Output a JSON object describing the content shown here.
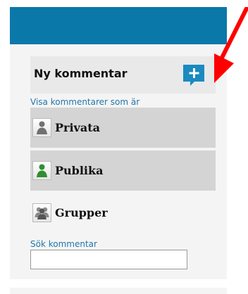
{
  "new_comment": {
    "label": "Ny kommentar",
    "add_icon": "plus-icon"
  },
  "filter": {
    "label": "Visa kommentarer som är",
    "options": [
      {
        "label": "Privata",
        "icon": "user-icon",
        "icon_color": "#707070",
        "selected": true
      },
      {
        "label": "Publika",
        "icon": "user-icon",
        "icon_color": "#2f8f2f",
        "selected": true
      },
      {
        "label": "Grupper",
        "icon": "group-icon",
        "icon_color": "#707070",
        "selected": false
      }
    ]
  },
  "search": {
    "label": "Sök kommentar",
    "value": "",
    "placeholder": ""
  },
  "colors": {
    "header": "#0a78a8",
    "accent": "#2277aa",
    "add_button": "#1a8ac0",
    "arrow": "#ff0000"
  }
}
